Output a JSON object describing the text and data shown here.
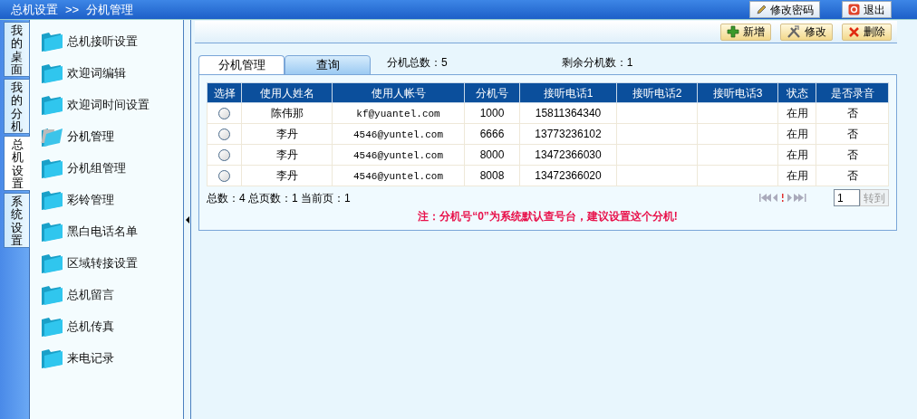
{
  "header": {
    "breadcrumb": [
      "总机设置",
      "分机管理"
    ],
    "separator": ">>",
    "buttons": [
      {
        "label": "修改密码",
        "kind": "pencil"
      },
      {
        "label": "退出",
        "kind": "exit"
      }
    ]
  },
  "side_tabs": [
    {
      "label": "我的桌面",
      "selected": false
    },
    {
      "label": "我的分机",
      "selected": false
    },
    {
      "label": "总机设置",
      "selected": true
    },
    {
      "label": "系统设置",
      "selected": false
    }
  ],
  "menu": [
    {
      "label": "总机接听设置",
      "selected": false
    },
    {
      "label": "欢迎词编辑",
      "selected": false
    },
    {
      "label": "欢迎词时间设置",
      "selected": false
    },
    {
      "label": "分机管理",
      "selected": true
    },
    {
      "label": "分机组管理",
      "selected": false
    },
    {
      "label": "彩铃管理",
      "selected": false
    },
    {
      "label": "黑白电话名单",
      "selected": false
    },
    {
      "label": "区域转接设置",
      "selected": false
    },
    {
      "label": "总机留言",
      "selected": false
    },
    {
      "label": "总机传真",
      "selected": false
    },
    {
      "label": "来电记录",
      "selected": false
    }
  ],
  "toolbar": [
    {
      "label": "新增",
      "kind": "add"
    },
    {
      "label": "修改",
      "kind": "tools"
    },
    {
      "label": "删除",
      "kind": "delete"
    }
  ],
  "tabs": [
    {
      "label": "分机管理",
      "selected": true
    },
    {
      "label": "查询",
      "selected": false
    }
  ],
  "stats": [
    "分机总数：5",
    "剩余分机数：1"
  ],
  "table": {
    "columns": [
      "选择",
      "使用人姓名",
      "使用人帐号",
      "分机号",
      "接听电话1",
      "接听电话2",
      "接听电话3",
      "状态",
      "是否录音"
    ],
    "rows": [
      {
        "selected": false,
        "cells": [
          "",
          "陈伟那",
          "kf@yuantel.com",
          "1000",
          "15811364340",
          "",
          "",
          "在用",
          "否"
        ]
      },
      {
        "selected": false,
        "cells": [
          "",
          "李丹",
          "4546@yuntel.com",
          "6666",
          "13773236102",
          "",
          "",
          "在用",
          "否"
        ]
      },
      {
        "selected": false,
        "cells": [
          "",
          "李丹",
          "4546@yuntel.com",
          "8000",
          "13472366030",
          "",
          "",
          "在用",
          "否"
        ]
      },
      {
        "selected": false,
        "cells": [
          "",
          "李丹",
          "4546@yuntel.com",
          "8008",
          "13472366020",
          "",
          "",
          "在用",
          "否"
        ]
      }
    ]
  },
  "summary": "总数：4 总页数：1 当前页：1",
  "pager": {
    "page": "1",
    "go": "转到"
  },
  "note": "注：分机号“0”为系统默认查号台，建议设置这个分机!"
}
